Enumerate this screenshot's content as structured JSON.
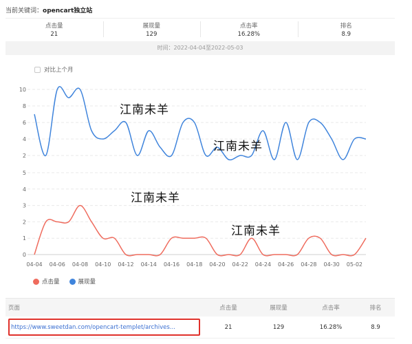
{
  "keyword": {
    "label": "当前关键词：",
    "value": "opencart独立站"
  },
  "stats": [
    {
      "label": "点击量",
      "value": "21"
    },
    {
      "label": "展现量",
      "value": "129"
    },
    {
      "label": "点击率",
      "value": "16.28%"
    },
    {
      "label": "排名",
      "value": "8.9"
    }
  ],
  "time_range": "时间：2022-04-04至2022-05-03",
  "compare_label": "对比上个月",
  "watermark": "江南未羊",
  "legend": {
    "clicks": "点击量",
    "impressions": "展现量"
  },
  "colors": {
    "clicks": "#ef6b5d",
    "impressions": "#3f84dc"
  },
  "chart_data": {
    "type": "line",
    "x": [
      "04-04",
      "04-05",
      "04-06",
      "04-07",
      "04-08",
      "04-09",
      "04-10",
      "04-11",
      "04-12",
      "04-13",
      "04-14",
      "04-15",
      "04-16",
      "04-17",
      "04-18",
      "04-19",
      "04-20",
      "04-21",
      "04-22",
      "04-23",
      "04-24",
      "04-25",
      "04-26",
      "04-27",
      "04-28",
      "04-29",
      "04-30",
      "05-01",
      "05-02",
      "05-03"
    ],
    "x_tick_labels": [
      "04-04",
      "04-06",
      "04-08",
      "04-10",
      "04-12",
      "04-14",
      "04-16",
      "04-18",
      "04-20",
      "04-22",
      "04-24",
      "04-26",
      "04-28",
      "04-30",
      "05-02"
    ],
    "panels": [
      {
        "series_name": "展现量",
        "ylim": [
          0,
          10
        ],
        "yticks": [
          "0",
          "2",
          "4",
          "6",
          "8",
          "10"
        ],
        "values": [
          7,
          2,
          10,
          9,
          10,
          5,
          4,
          5,
          6,
          2,
          5,
          3,
          2,
          6,
          6,
          2,
          3,
          1.5,
          2,
          2,
          5,
          1.5,
          6,
          1.5,
          6,
          6,
          4,
          1.5,
          4,
          4
        ]
      },
      {
        "series_name": "点击量",
        "ylim": [
          0,
          5
        ],
        "yticks": [
          "0",
          "1",
          "2",
          "3",
          "4",
          "5"
        ],
        "values": [
          0,
          2,
          2,
          2,
          3,
          2,
          1,
          1,
          0,
          0,
          0,
          0,
          1,
          1,
          1,
          1,
          0,
          0,
          0,
          1,
          0,
          0,
          0,
          0,
          1,
          1,
          0,
          0,
          0,
          1
        ]
      }
    ]
  },
  "table": {
    "headers": {
      "page": "页面",
      "clicks": "点击量",
      "impressions": "展现量",
      "ctr": "点击率",
      "rank": "排名"
    },
    "rows": [
      {
        "url": "https://www.sweetdan.com/opencart-templet/archives...",
        "clicks": "21",
        "impressions": "129",
        "ctr": "16.28%",
        "rank": "8.9"
      }
    ]
  }
}
